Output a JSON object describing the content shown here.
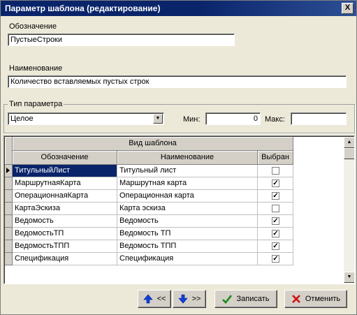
{
  "window": {
    "title": "Параметр шаблона (редактирование)",
    "close_label": "X"
  },
  "designation": {
    "label": "Обозначение",
    "value": "ПустыеСтроки"
  },
  "name": {
    "label": "Наименование",
    "value": "Количество вставляемых пустых строк"
  },
  "param_type": {
    "label": "Тип параметра",
    "value": "Целое"
  },
  "min": {
    "label": "Мин:",
    "value": "0"
  },
  "max": {
    "label": "Макс:",
    "value": ""
  },
  "grid": {
    "group_header": "Вид шаблона",
    "columns": [
      "Обозначение",
      "Наименование",
      "Выбран"
    ],
    "rows": [
      {
        "code": "ТитульныйЛист",
        "name": "Титульный лист",
        "checked": false,
        "selected": true
      },
      {
        "code": "МаршрутнаяКарта",
        "name": "Маршрутная карта",
        "checked": true,
        "selected": false
      },
      {
        "code": "ОперационнаяКарта",
        "name": "Операционная карта",
        "checked": true,
        "selected": false
      },
      {
        "code": "КартаЭскиза",
        "name": "Карта эскиза",
        "checked": false,
        "selected": false
      },
      {
        "code": "Ведомость",
        "name": "Ведомость",
        "checked": true,
        "selected": false
      },
      {
        "code": "ВедомостьТП",
        "name": "Ведомость ТП",
        "checked": true,
        "selected": false
      },
      {
        "code": "ВедомостьТПП",
        "name": "Ведомость ТПП",
        "checked": true,
        "selected": false
      },
      {
        "code": "Спецификация",
        "name": "Спецификация",
        "checked": true,
        "selected": false
      }
    ]
  },
  "buttons": {
    "up": "<<",
    "down": ">>",
    "save": "Записать",
    "cancel": "Отменить"
  },
  "colors": {
    "titlebar": "#0a246a",
    "selection": "#0a246a",
    "arrow_blue": "#1040e0",
    "check_green": "#1a8a1a",
    "cancel_red": "#d01010"
  }
}
